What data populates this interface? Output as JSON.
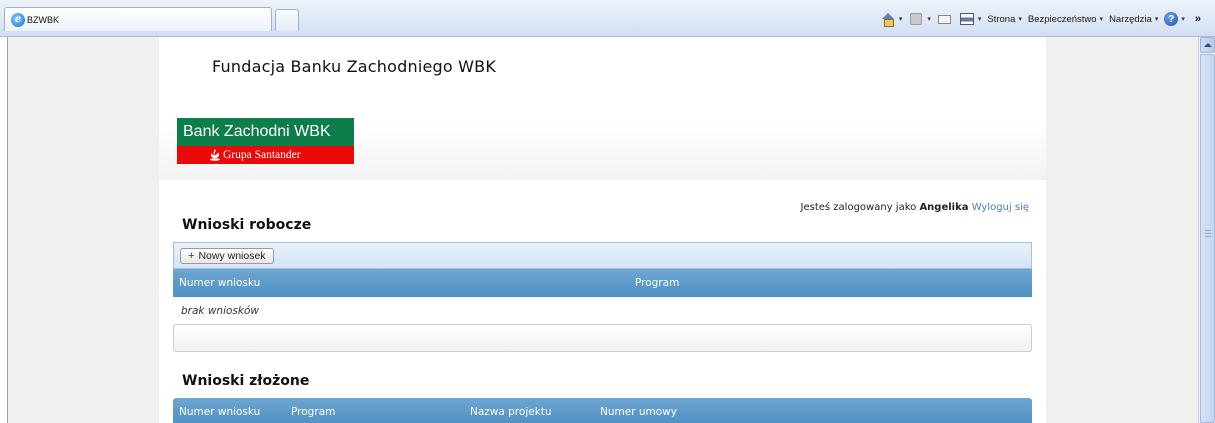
{
  "browser": {
    "tab_title": "BZWBK",
    "commands": {
      "page": "Strona",
      "security": "Bezpieczeństwo",
      "tools": "Narzędzia",
      "more": "»"
    }
  },
  "header": {
    "foundation_title": "Fundacja Banku Zachodniego WBK",
    "logo": {
      "bank_name": "Bank Zachodni WBK",
      "group_name": "Grupa Santander",
      "green": "#0d7d4a",
      "red": "#ea0a0a"
    }
  },
  "session": {
    "prefix": "Jesteś zalogowany jako",
    "user": "Angelika",
    "logout": "Wyloguj się"
  },
  "drafts": {
    "title": "Wnioski robocze",
    "new_button": "Nowy wniosek",
    "columns": [
      "Numer wniosku",
      "Program"
    ],
    "empty": "brak wniosków"
  },
  "submitted": {
    "title": "Wnioski złożone",
    "columns": [
      "Numer wniosku",
      "Program",
      "Nazwa projektu",
      "Numer umowy"
    ]
  },
  "colors": {
    "grid_header": "#5a97c8",
    "link": "#4a7ec0"
  }
}
